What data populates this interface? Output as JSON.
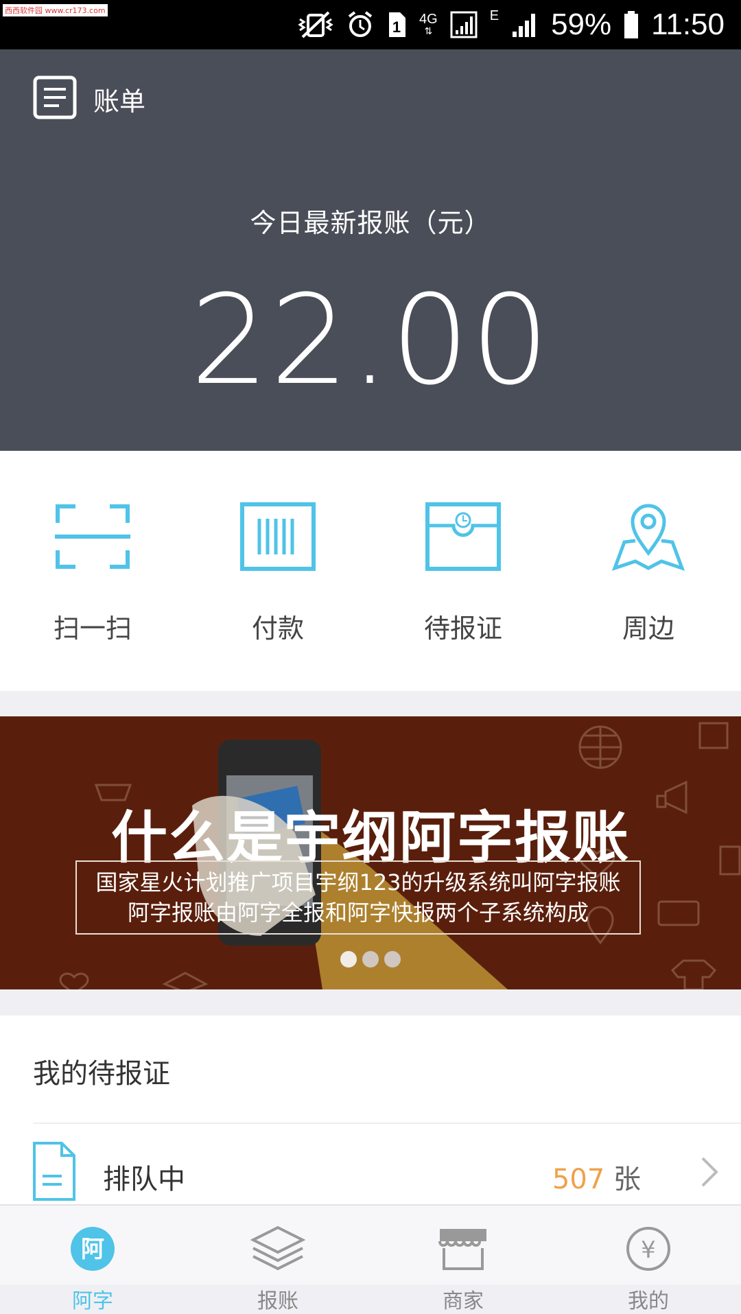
{
  "status_bar": {
    "watermark": "西西软件园 www.cr173.com",
    "sim_slot": "1",
    "network_4g": "4G",
    "network_e": "E",
    "battery": "59%",
    "time": "11:50"
  },
  "header": {
    "bill_label": "账单",
    "today_label": "今日最新报账（元）",
    "amount": "22.00"
  },
  "actions": [
    {
      "label": "扫一扫",
      "icon": "scan-icon"
    },
    {
      "label": "付款",
      "icon": "barcode-icon"
    },
    {
      "label": "待报证",
      "icon": "receipt-clock-icon"
    },
    {
      "label": "周边",
      "icon": "map-pin-icon"
    }
  ],
  "banner": {
    "title": "什么是宇纲阿字报账",
    "line1": "国家星火计划推广项目宇纲123的升级系统叫阿字报账",
    "line2": "阿字报账由阿字全报和阿字快报两个子系统构成",
    "dots_count": 3,
    "active_dot": 0
  },
  "pending": {
    "title": "我的待报证",
    "rows": [
      {
        "label": "排队中",
        "count": "507",
        "unit": "张"
      }
    ]
  },
  "tabbar": {
    "tabs": [
      {
        "label": "阿字",
        "icon": "home-a-icon",
        "active": true
      },
      {
        "label": "报账",
        "icon": "layers-icon",
        "active": false
      },
      {
        "label": "商家",
        "icon": "store-icon",
        "active": false
      },
      {
        "label": "我的",
        "icon": "yen-icon",
        "active": false
      }
    ]
  },
  "colors": {
    "header_bg": "#4a4e58",
    "accent": "#4fc3e8",
    "banner_bg": "#5a1f0c",
    "count_orange": "#f0a14a"
  }
}
